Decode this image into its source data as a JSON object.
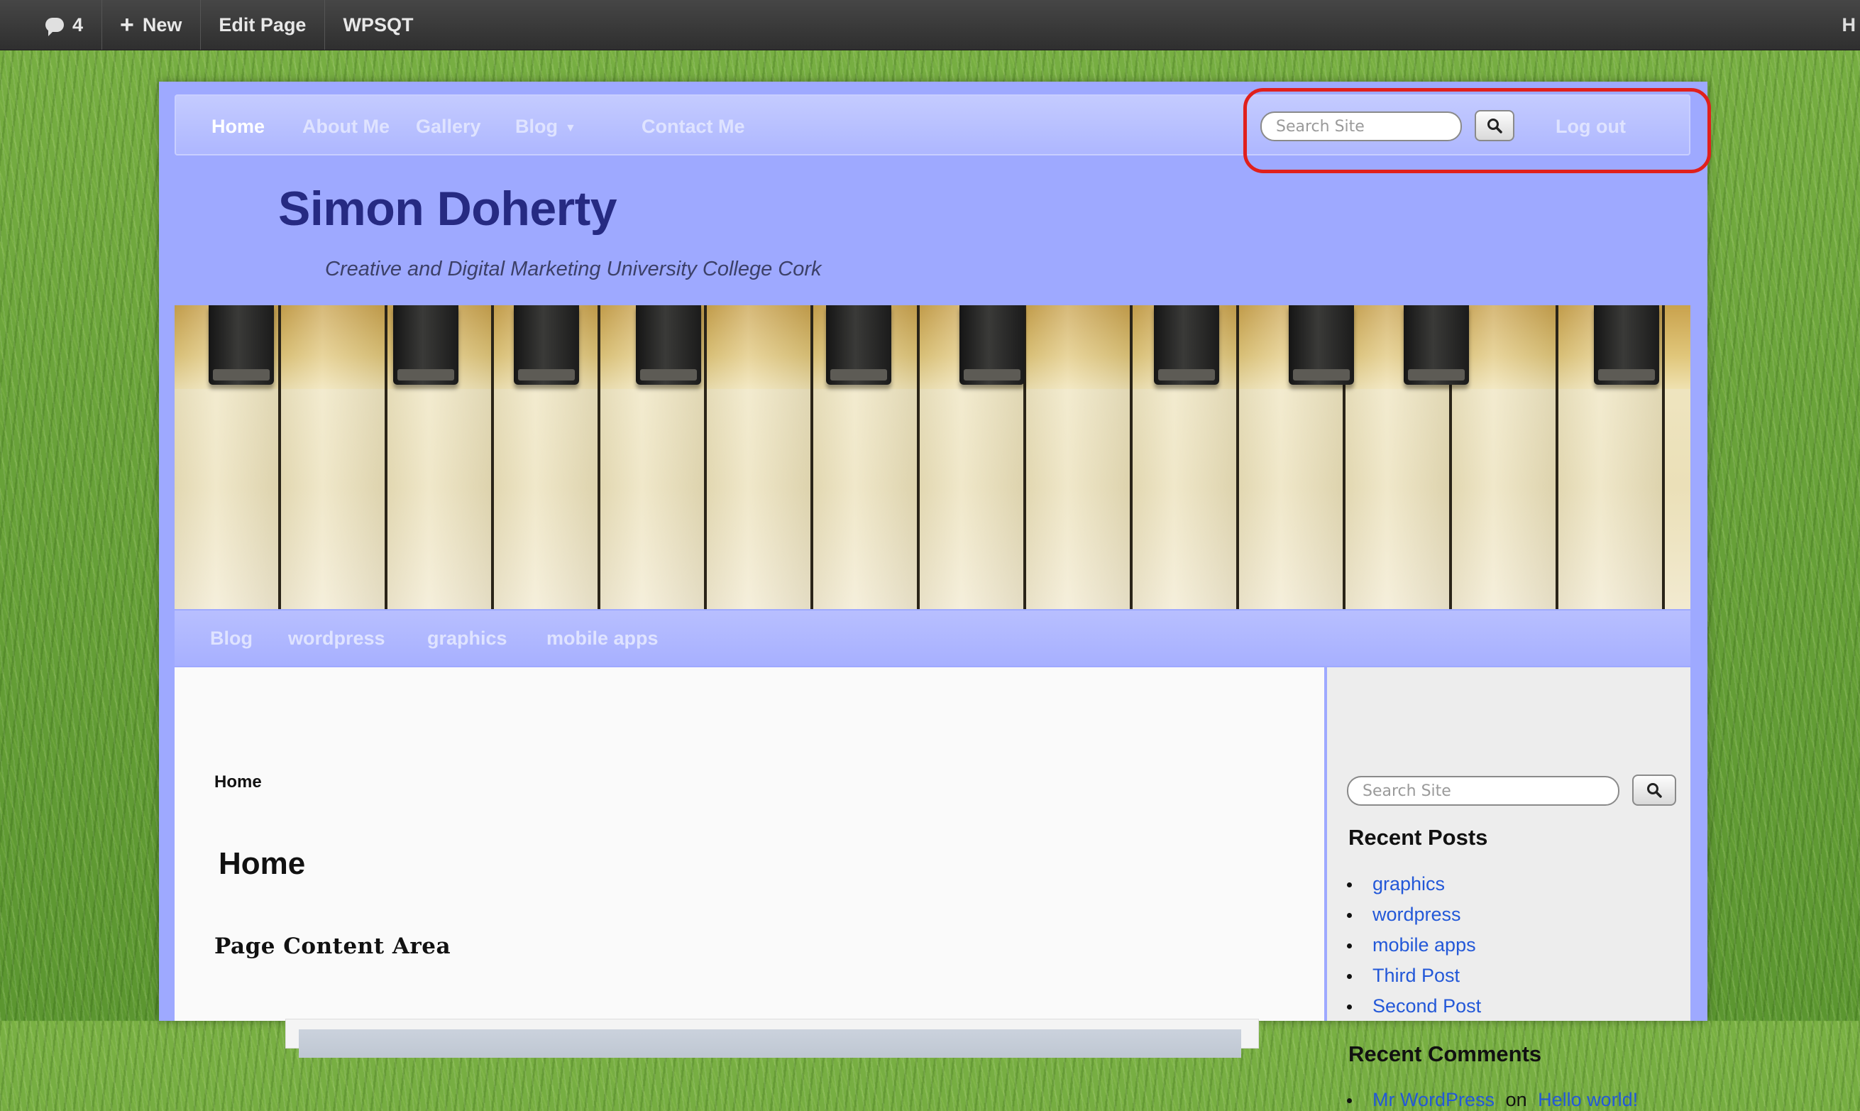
{
  "admin_bar": {
    "comments_count": "4",
    "new_label": "New",
    "edit_page_label": "Edit Page",
    "site_name": "WPSQT",
    "right_text": "H"
  },
  "primary_nav": {
    "items": [
      "Home",
      "About Me",
      "Gallery",
      "Blog",
      "Contact Me"
    ],
    "current": "Home",
    "search_placeholder": "Search Site",
    "logout_label": "Log out"
  },
  "site": {
    "title": "Simon Doherty",
    "description": "Creative and Digital Marketing University College Cork"
  },
  "category_nav": {
    "items": [
      "Blog",
      "wordpress",
      "graphics",
      "mobile apps"
    ]
  },
  "content": {
    "breadcrumb": "Home",
    "page_title": "Home",
    "heading": "Page Content Area"
  },
  "sidebar": {
    "search_placeholder": "Search Site",
    "recent_posts_title": "Recent Posts",
    "recent_posts": [
      "graphics",
      "wordpress",
      "mobile apps",
      "Third Post",
      "Second Post"
    ],
    "recent_comments_title": "Recent Comments",
    "recent_comments": [
      {
        "author": "Mr WordPress",
        "connector": "on",
        "post": "Hello world!"
      }
    ]
  },
  "colors": {
    "site_background": "#9ea9ff",
    "title_color": "#262a82",
    "highlight_ring": "#e0201c",
    "link_color": "#2358d8"
  }
}
